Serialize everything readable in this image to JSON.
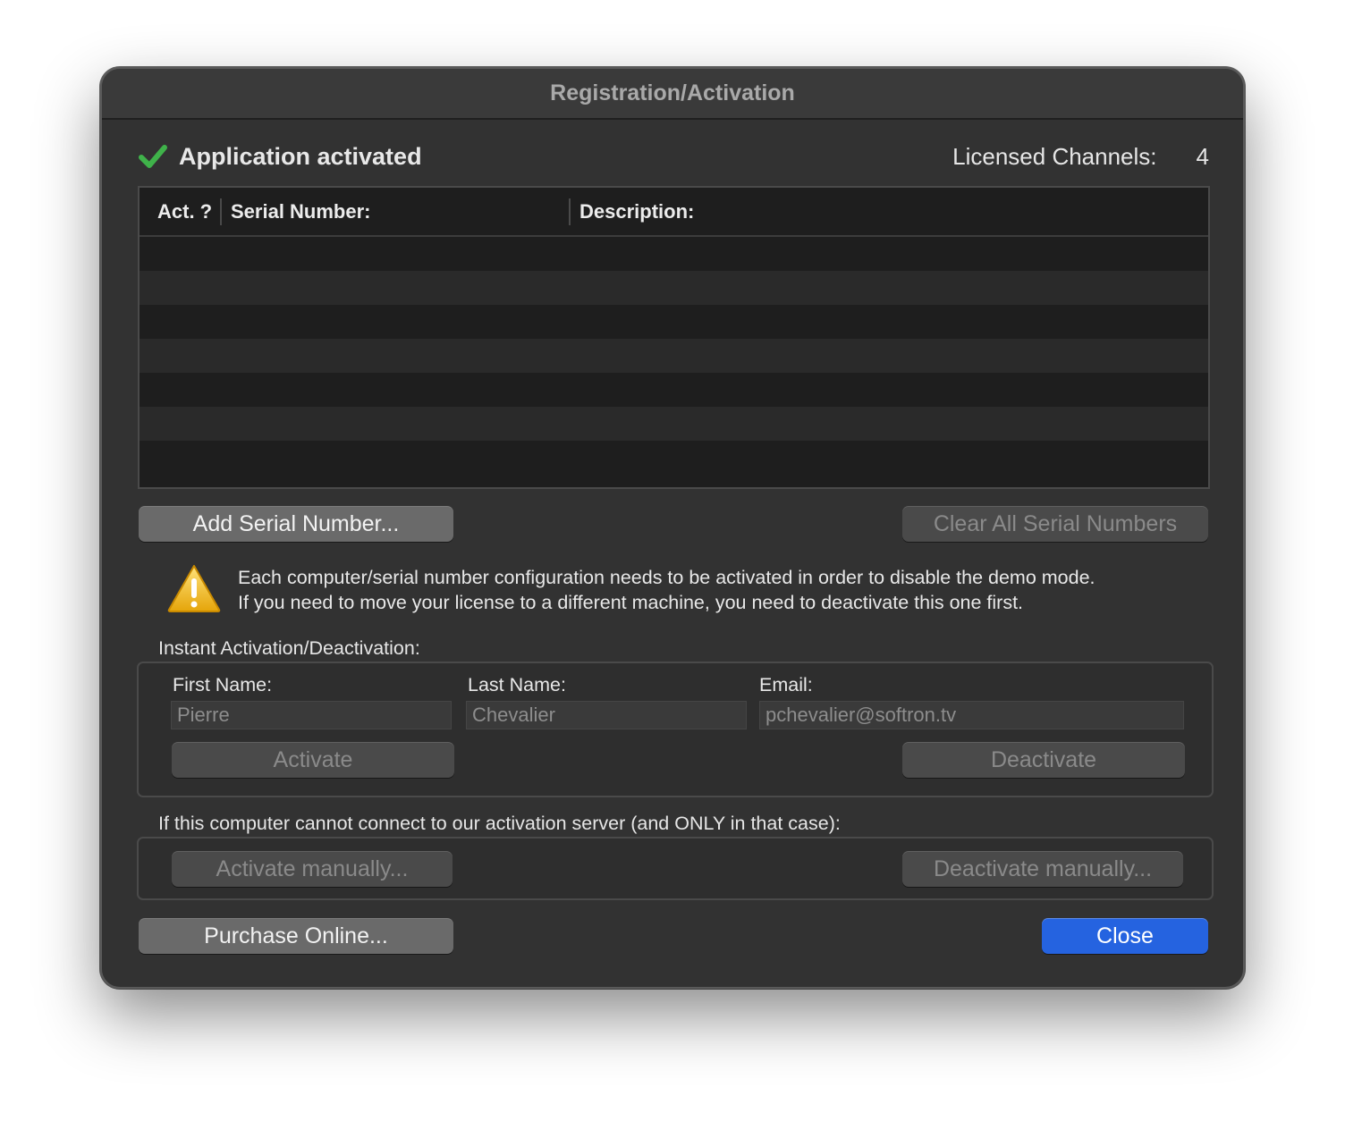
{
  "window": {
    "title": "Registration/Activation"
  },
  "status": {
    "text": "Application activated",
    "licensed_label": "Licensed Channels:",
    "licensed_count": "4",
    "icon": "checkmark-icon",
    "icon_color": "#3fb24a"
  },
  "table": {
    "columns": [
      "Act. ?",
      "Serial Number:",
      "Description:"
    ],
    "rows": []
  },
  "serial_buttons": {
    "add": "Add Serial Number...",
    "clear_all": "Clear All Serial Numbers"
  },
  "warning": {
    "icon": "warning-icon",
    "line1": "Each computer/serial number configuration needs to be activated in order to disable the demo mode.",
    "line2": "If you need to move your license to a different machine, you need to deactivate this one first."
  },
  "instant": {
    "section_label": "Instant Activation/Deactivation:",
    "first_name_label": "First Name:",
    "first_name_value": "Pierre",
    "last_name_label": "Last Name:",
    "last_name_value": "Chevalier",
    "email_label": "Email:",
    "email_value": "pchevalier@softron.tv",
    "activate": "Activate",
    "deactivate": "Deactivate"
  },
  "manual": {
    "section_label": "If this computer cannot connect to our activation server (and ONLY in that case):",
    "activate": "Activate manually...",
    "deactivate": "Deactivate manually..."
  },
  "footer": {
    "purchase": "Purchase Online...",
    "close": "Close",
    "accent_color": "#2563e0"
  }
}
